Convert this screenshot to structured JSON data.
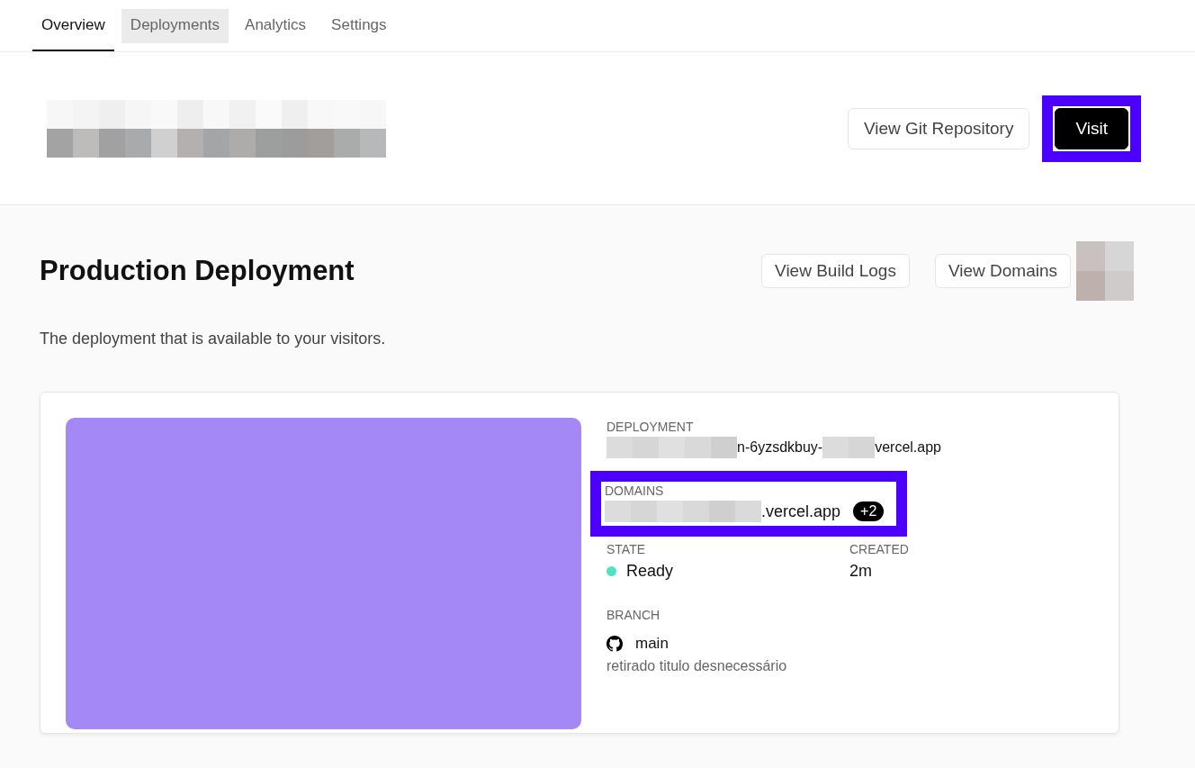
{
  "tabs": [
    {
      "label": "Overview",
      "selected": true,
      "hovered": false
    },
    {
      "label": "Deployments",
      "selected": false,
      "hovered": true
    },
    {
      "label": "Analytics",
      "selected": false,
      "hovered": false
    },
    {
      "label": "Settings",
      "selected": false,
      "hovered": false
    }
  ],
  "header": {
    "title": [
      {
        "kind": "redacted_title"
      }
    ],
    "actions": [
      {
        "label": "View Git Repository",
        "kind": "secondary",
        "highlighted": false
      },
      {
        "label": "Visit",
        "kind": "primary",
        "highlighted": true
      }
    ]
  },
  "production": {
    "title": "Production Deployment",
    "description": "The deployment that is available to your visitors.",
    "actions": [
      {
        "label": "View Build Logs",
        "kind": "secondary",
        "highlighted": false
      },
      {
        "label": "View Domains",
        "kind": "secondary",
        "highlighted": false
      }
    ],
    "card": {
      "preview": {
        "color": "#a388f6"
      },
      "deployment": {
        "label": "DEPLOYMENT",
        "parts": [
          {
            "kind": "redacted_long"
          },
          {
            "kind": "text",
            "text": "n-6yzsdkbuy-"
          },
          {
            "kind": "redacted_short"
          },
          {
            "kind": "text",
            "text": "vercel.app"
          }
        ]
      },
      "domains": {
        "label": "DOMAINS",
        "highlighted": true,
        "parts": [
          {
            "kind": "redacted_wide"
          },
          {
            "kind": "text",
            "text": ".vercel.app"
          }
        ],
        "extra": "+2"
      },
      "state": {
        "label": "STATE",
        "value": "Ready",
        "color": "#50e3c2"
      },
      "created": {
        "label": "CREATED",
        "value": "2m"
      },
      "branch": {
        "label": "BRANCH",
        "name": "main",
        "commit": "retirado titulo desnecessário"
      }
    }
  }
}
